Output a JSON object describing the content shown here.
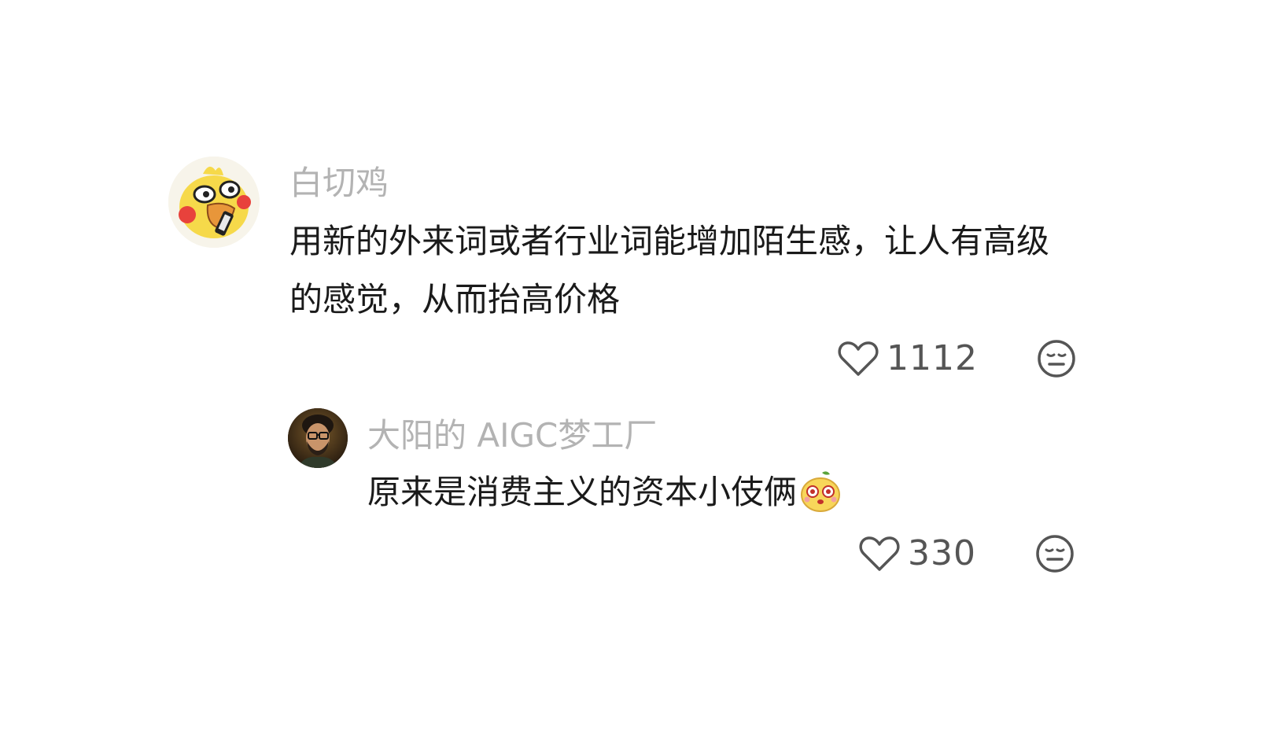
{
  "comments": [
    {
      "username": "白切鸡",
      "avatar": "duck-avatar",
      "text": "用新的外来词或者行业词能增加陌生感，让人有高级的感觉，从而抬高价格",
      "likes": "1112",
      "replies": [
        {
          "username": "大阳的 AIGC梦工厂",
          "avatar": "man-with-glasses-avatar",
          "text": "原来是消费主义的资本小伎俩",
          "emoji": "dizzy-face-emoji",
          "likes": "330"
        }
      ]
    }
  ],
  "icons": {
    "like": "heart-outline-icon",
    "dislike": "meh-face-icon"
  },
  "colors": {
    "background": "#ffffff",
    "username": "#b3b3b3",
    "body_text": "#1a1a1a",
    "count": "#555555",
    "icon": "#555555"
  }
}
